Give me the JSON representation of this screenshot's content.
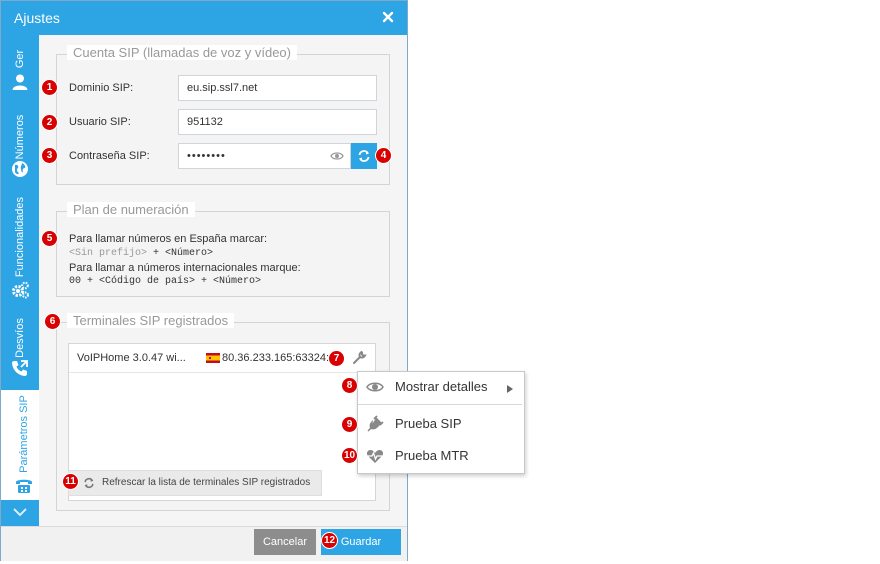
{
  "window": {
    "title": "Ajustes"
  },
  "sidebar": {
    "tabs": [
      {
        "label": "Ger",
        "icon": "user-icon",
        "active": false
      },
      {
        "label": "Números",
        "icon": "globe-icon",
        "active": false
      },
      {
        "label": "Funcionalidades",
        "icon": "gears-icon",
        "active": false
      },
      {
        "label": "Desvíos",
        "icon": "phone-forward-icon",
        "active": false
      },
      {
        "label": "Parámetros SIP",
        "icon": "phone-icon",
        "active": true
      }
    ],
    "scroll_down_icon": "chevron-down-icon"
  },
  "sip_account": {
    "legend": "Cuenta SIP (llamadas de voz y vídeo)",
    "domain_label": "Dominio SIP:",
    "domain_value": "eu.sip.ssl7.net",
    "user_label": "Usuario SIP:",
    "user_value": "951132",
    "password_label": "Contraseña SIP:",
    "password_value": "••••••••"
  },
  "numbering_plan": {
    "legend": "Plan de numeración",
    "line1": "Para llamar números en España marcar:",
    "line2_prefix": "<Sin prefijo>",
    "line2_rest": " + <Número>",
    "line3": "Para llamar a números internacionales marque:",
    "line4": "00 + <Código de país> + <Número>"
  },
  "terminals": {
    "legend": "Terminales SIP registrados",
    "rows": [
      {
        "client": "VoIPHome 3.0.47 wi...",
        "flag": "Spain",
        "address": "80.36.233.165:63324:..."
      }
    ],
    "refresh_label": "Refrescar la lista de terminales SIP registrados"
  },
  "context_menu": {
    "items": [
      {
        "label": "Mostrar detalles",
        "icon": "eye-icon",
        "submenu": true
      },
      {
        "label": "Prueba SIP",
        "icon": "plug-icon",
        "submenu": false
      },
      {
        "label": "Prueba MTR",
        "icon": "heartbeat-icon",
        "submenu": false
      }
    ]
  },
  "footer": {
    "cancel_label": "Cancelar",
    "save_label": "Guardar"
  },
  "badges": [
    "1",
    "2",
    "3",
    "4",
    "5",
    "6",
    "7",
    "8",
    "9",
    "10",
    "11",
    "12"
  ],
  "colors": {
    "accent": "#2da4e4",
    "badge": "#d80000",
    "cancel": "#8d8d8d"
  }
}
